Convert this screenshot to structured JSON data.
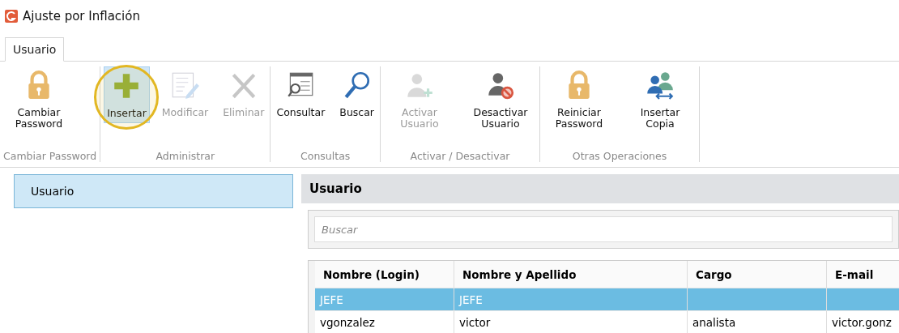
{
  "window": {
    "title": "Ajuste por Inflación"
  },
  "tabs": [
    {
      "label": "Usuario",
      "selected": true
    }
  ],
  "ribbon": {
    "groups": [
      {
        "label": "Cambiar Password",
        "buttons": [
          {
            "label": "Cambiar Password",
            "disabled": false,
            "pressed": false,
            "highlighted": false
          }
        ]
      },
      {
        "label": "Administrar",
        "buttons": [
          {
            "label": "Insertar",
            "disabled": false,
            "pressed": true,
            "highlighted": true
          },
          {
            "label": "Modificar",
            "disabled": true,
            "pressed": false,
            "highlighted": false
          },
          {
            "label": "Eliminar",
            "disabled": true,
            "pressed": false,
            "highlighted": false
          }
        ]
      },
      {
        "label": "Consultas",
        "buttons": [
          {
            "label": "Consultar",
            "disabled": false,
            "pressed": false,
            "highlighted": false
          },
          {
            "label": "Buscar",
            "disabled": false,
            "pressed": false,
            "highlighted": false
          }
        ]
      },
      {
        "label": "Activar / Desactivar",
        "buttons": [
          {
            "label": "Activar Usuario",
            "disabled": true,
            "pressed": false,
            "highlighted": false
          },
          {
            "label": "Desactivar Usuario",
            "disabled": false,
            "pressed": false,
            "highlighted": false
          }
        ]
      },
      {
        "label": "Otras Operaciones",
        "buttons": [
          {
            "label": "Reiniciar Password",
            "disabled": false,
            "pressed": false,
            "highlighted": false
          },
          {
            "label": "Insertar Copia",
            "disabled": false,
            "pressed": false,
            "highlighted": false
          }
        ]
      }
    ]
  },
  "sidebar": {
    "items": [
      {
        "label": "Usuario",
        "selected": true
      }
    ]
  },
  "panel": {
    "title": "Usuario",
    "search": {
      "placeholder": "Buscar"
    },
    "table": {
      "columns": [
        "Nombre (Login)",
        "Nombre y Apellido",
        "Cargo",
        "E-mail"
      ],
      "rows": [
        {
          "cells": [
            "JEFE",
            "JEFE",
            "",
            ""
          ],
          "selected": true
        },
        {
          "cells": [
            "vgonzalez",
            "victor",
            "analista",
            "victor.gonz"
          ],
          "selected": false
        }
      ]
    }
  }
}
